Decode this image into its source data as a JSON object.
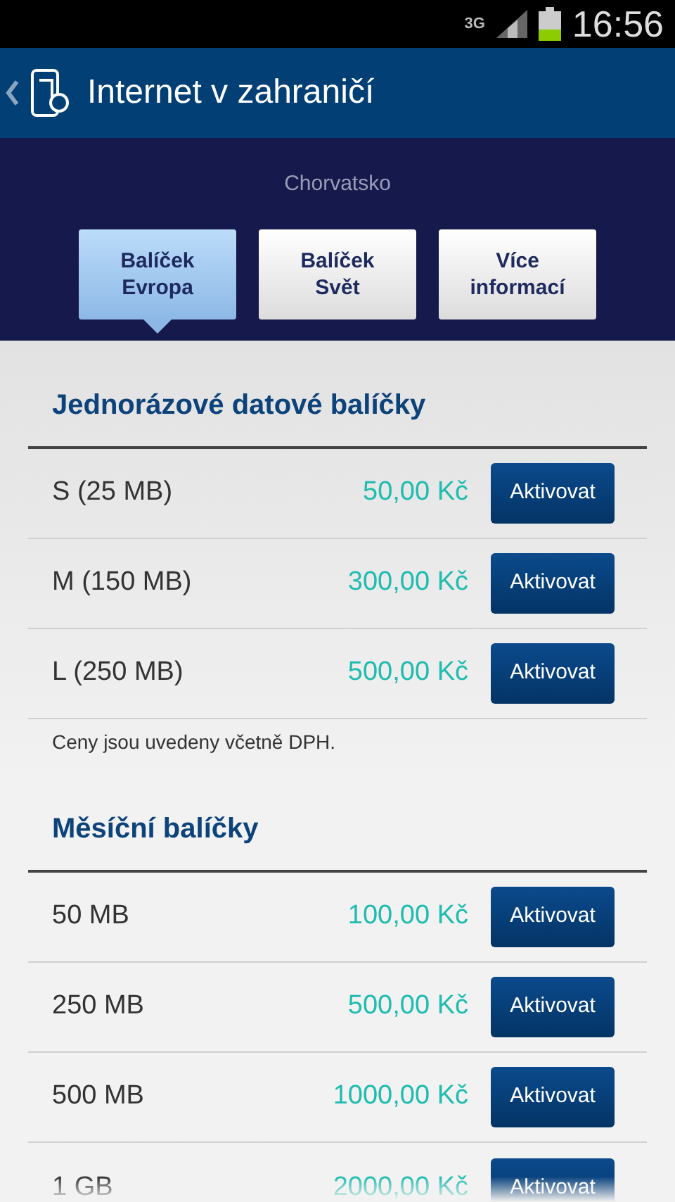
{
  "status_bar": {
    "network": "3G",
    "time": "16:56"
  },
  "header": {
    "title": "Internet v zahraničí"
  },
  "country": "Chorvatsko",
  "tabs": [
    {
      "label": "Balíček Evropa",
      "selected": true
    },
    {
      "label": "Balíček Svět",
      "selected": false
    },
    {
      "label": "Více informací",
      "selected": false
    }
  ],
  "sections": [
    {
      "title": "Jednorázové datové balíčky",
      "rows": [
        {
          "name": "S (25 MB)",
          "price": "50,00 Kč",
          "button": "Aktivovat"
        },
        {
          "name": "M (150 MB)",
          "price": "300,00 Kč",
          "button": "Aktivovat"
        },
        {
          "name": "L (250 MB)",
          "price": "500,00 Kč",
          "button": "Aktivovat"
        }
      ],
      "note": "Ceny jsou uvedeny včetně DPH."
    },
    {
      "title": "Měsíční balíčky",
      "rows": [
        {
          "name": "50 MB",
          "price": "100,00 Kč",
          "button": "Aktivovat"
        },
        {
          "name": "250 MB",
          "price": "500,00 Kč",
          "button": "Aktivovat"
        },
        {
          "name": "500 MB",
          "price": "1000,00 Kč",
          "button": "Aktivovat"
        },
        {
          "name": "1 GB",
          "price": "2000,00 Kč",
          "button": "Aktivovat"
        }
      ]
    }
  ]
}
